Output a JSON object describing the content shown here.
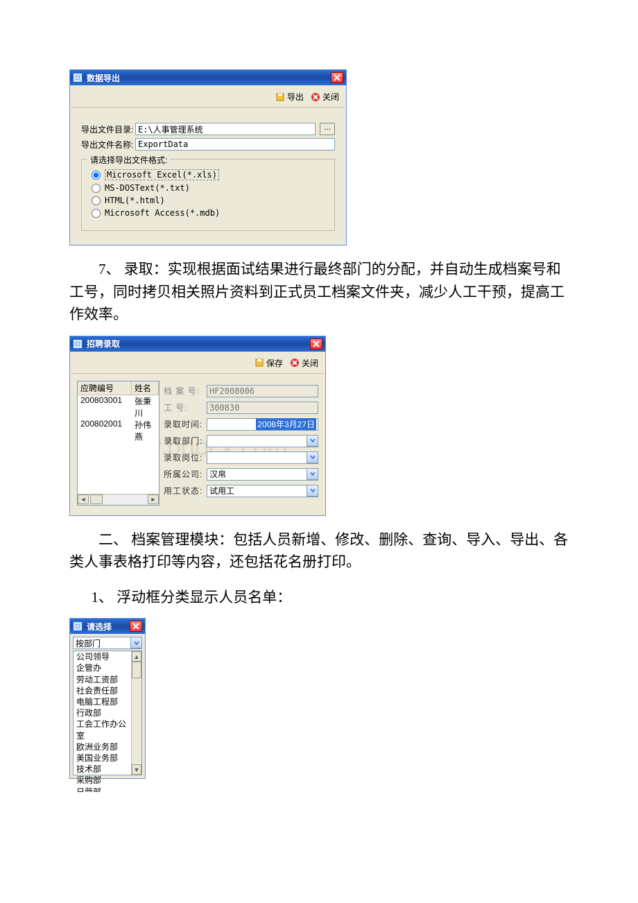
{
  "export_dialog": {
    "title": "数据导出",
    "toolbar": {
      "export": "导出",
      "close": "关闭"
    },
    "dir_label": "导出文件目录:",
    "dir_value": "E:\\人事管理系统",
    "name_label": "导出文件名称:",
    "name_value": "ExportData",
    "format_legend": "请选择导出文件格式:",
    "formats": [
      "Microsoft Excel(*.xls)",
      "MS-DOSText(*.txt)",
      "HTML(*.html)",
      "Microsoft Access(*.mdb)"
    ]
  },
  "para_7": "7、 录取：实现根据面试结果进行最终部门的分配，并自动生成档案号和工号，同时拷贝相关照片资料到正式员工档案文件夹，减少人工干预，提高工作效率。",
  "recruit_dialog": {
    "title": "招聘录取",
    "toolbar": {
      "save": "保存",
      "close": "关闭"
    },
    "list": {
      "col1": "应聘编号",
      "col2": "姓名",
      "rows": [
        {
          "id": "200803001",
          "name": "张秉川"
        },
        {
          "id": "200802001",
          "name": "孙伟燕"
        }
      ]
    },
    "fields": {
      "file_no_label": "档 案 号:",
      "file_no_value": "HF2008006",
      "emp_no_label": "工    号:",
      "emp_no_value": "300830",
      "hire_time_label": "录取时间:",
      "hire_time_value": "2008年3月27日",
      "hire_dept_label": "录取部门:",
      "hire_dept_value": "",
      "hire_post_label": "录取岗位:",
      "hire_post_value": "",
      "company_label": "所属公司:",
      "company_value": "汉帛",
      "emp_status_label": "用工状态:",
      "emp_status_value": "试用工"
    }
  },
  "para_sec2": "二、 档案管理模块：包括人员新增、修改、删除、查询、导入、导出、各类人事表格打印等内容，还包括花名册打印。",
  "para_1": "1、 浮动框分类显示人员名单：",
  "select_dialog": {
    "title": "请选择",
    "combo": "按部门",
    "items": [
      "公司领导",
      "企管办",
      "劳动工资部",
      "社会责任部",
      "电脑工程部",
      "行政部",
      "工会工作办公室",
      "欧洲业务部",
      "美国业务部",
      "技术部",
      "采购部",
      "日营部"
    ]
  },
  "watermark": "www.bdocx.com"
}
